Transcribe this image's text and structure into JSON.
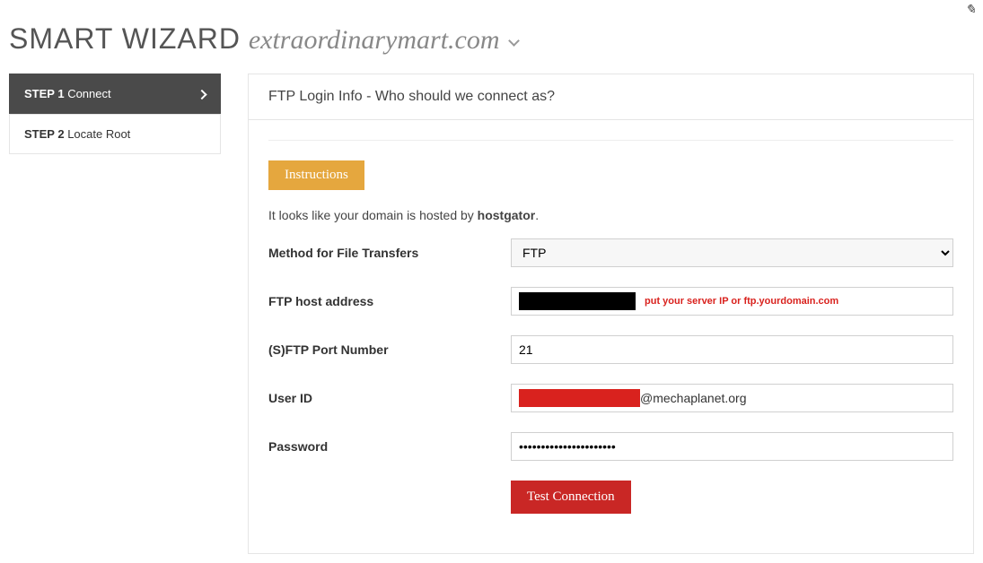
{
  "header": {
    "title": "SMART WIZARD",
    "domain": "extraordinarymart.com"
  },
  "sidebar": {
    "steps": [
      {
        "num": "STEP 1",
        "label": "Connect",
        "active": true
      },
      {
        "num": "STEP 2",
        "label": "Locate Root",
        "active": false
      }
    ]
  },
  "panel": {
    "title": "FTP Login Info - Who should we connect as?",
    "instructions_label": "Instructions",
    "hosted_prefix": "It looks like your domain is hosted by ",
    "hosted_host": "hostgator",
    "hosted_suffix": ".",
    "fields": {
      "method": {
        "label": "Method for File Transfers",
        "value": "FTP"
      },
      "host": {
        "label": "FTP host address",
        "hint": "put your server IP or ftp.yourdomain.com"
      },
      "port": {
        "label": "(S)FTP Port Number",
        "value": "21"
      },
      "user": {
        "label": "User ID",
        "suffix": "@mechaplanet.org"
      },
      "password": {
        "label": "Password",
        "value": "••••••••••••••••••••••"
      }
    },
    "test_button": "Test Connection"
  }
}
